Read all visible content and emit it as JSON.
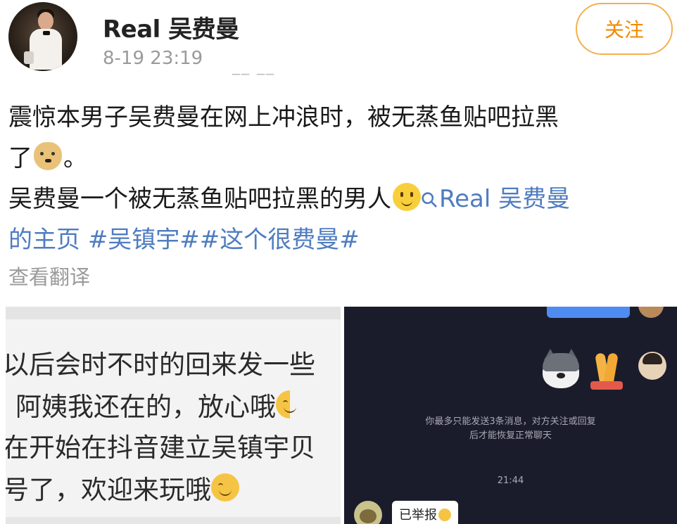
{
  "header": {
    "username": "Real 吴费曼",
    "time": "8-19 23:19",
    "source_redacted": "__ __",
    "follow_label": "关注"
  },
  "post": {
    "line1": "震惊本男子吴费曼在网上冲浪时，被无蒸鱼贴吧拉黑",
    "line2_pre": "了",
    "line2_post": "。",
    "line3": "吴费曼一个被无蒸鱼贴吧拉黑的男人",
    "link_part1": "Real 吴费曼",
    "link_part2": "的主页",
    "tag1": "#吴镇宇#",
    "tag2": "#这个很费曼#",
    "translate_label": "查看翻译"
  },
  "image_left": {
    "lines": [
      "以后会时不时的回来发一些",
      "阿姨我还在的，放心哦",
      "在开始在抖音建立吴镇宇贝",
      "号了，欢迎来玩哦"
    ]
  },
  "image_right": {
    "system_line1": "你最多只能发送3条消息，对方关注或回复",
    "system_line2": "后才能恢复正常聊天",
    "time": "21:44",
    "report_text": "已举报"
  },
  "colors": {
    "link": "#4f7cc0",
    "follow": "#f08a00",
    "chat_bg": "#1b1c2b"
  },
  "icons": [
    "avatar",
    "doge-emoji",
    "smile-emoji",
    "link-icon",
    "husky-sticker",
    "pray-emoji",
    "grin-emoji"
  ]
}
